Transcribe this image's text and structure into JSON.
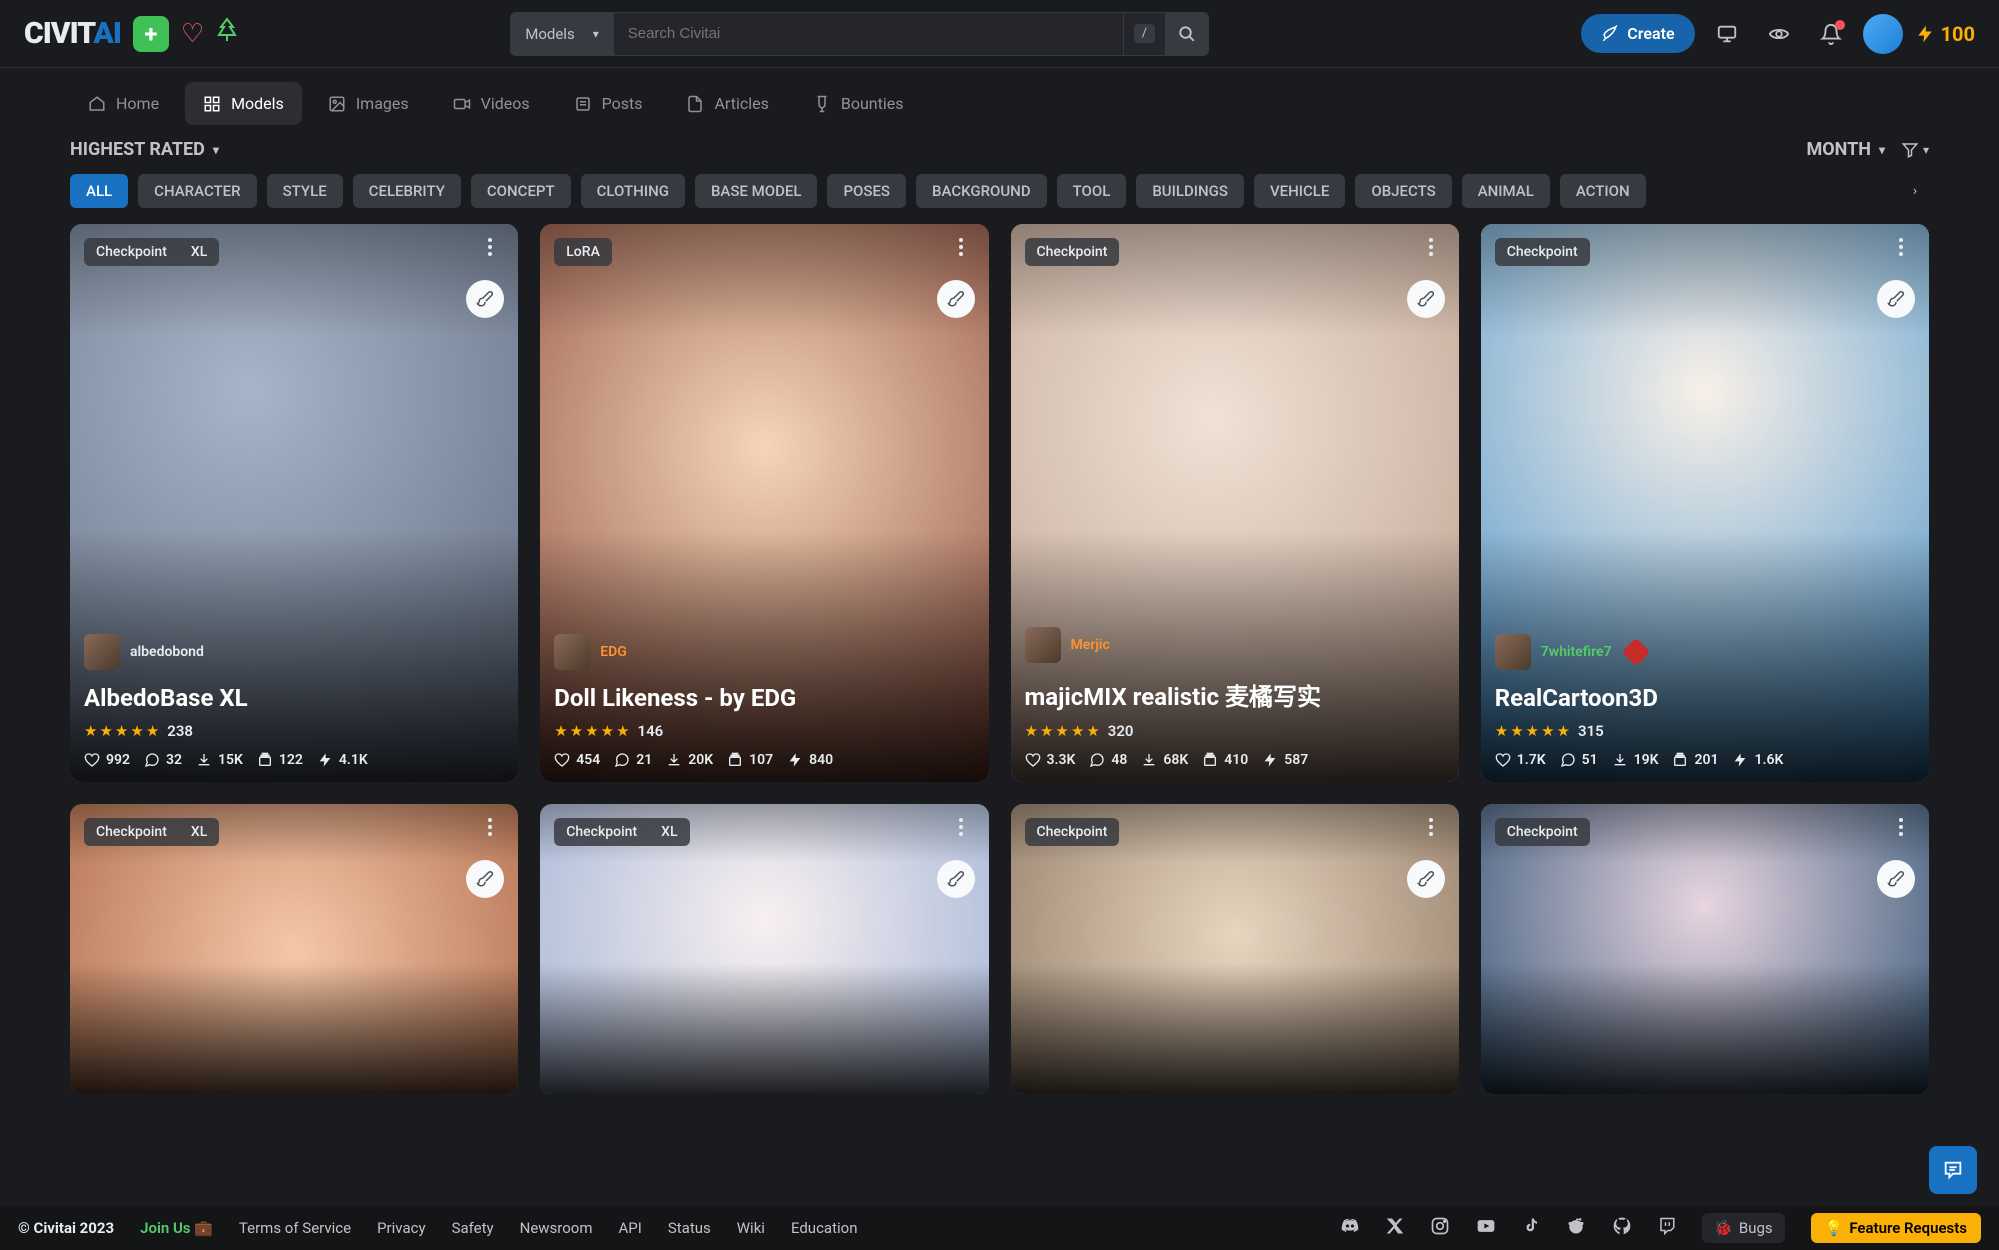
{
  "header": {
    "logo_left": "CIVIT",
    "logo_right": "AI",
    "search_select": "Models",
    "search_placeholder": "Search Civitai",
    "slash_key": "/",
    "create_label": "Create",
    "coins": "100"
  },
  "nav": {
    "items": [
      {
        "label": "Home"
      },
      {
        "label": "Models"
      },
      {
        "label": "Images"
      },
      {
        "label": "Videos"
      },
      {
        "label": "Posts"
      },
      {
        "label": "Articles"
      },
      {
        "label": "Bounties"
      }
    ]
  },
  "sort": {
    "label": "HIGHEST RATED",
    "period": "MONTH"
  },
  "tags": [
    "ALL",
    "CHARACTER",
    "STYLE",
    "CELEBRITY",
    "CONCEPT",
    "CLOTHING",
    "BASE MODEL",
    "POSES",
    "BACKGROUND",
    "TOOL",
    "BUILDINGS",
    "VEHICLE",
    "OBJECTS",
    "ANIMAL",
    "ACTION"
  ],
  "cards": [
    {
      "badges": [
        "Checkpoint",
        "XL"
      ],
      "author": "albedobond",
      "author_color": "",
      "title": "AlbedoBase XL",
      "rating": "238",
      "stats": {
        "likes": "992",
        "comments": "32",
        "downloads": "15K",
        "images": "122",
        "bolts": "4.1K"
      }
    },
    {
      "badges": [
        "LoRA"
      ],
      "author": "EDG",
      "author_color": "orange",
      "title": "Doll Likeness - by EDG",
      "rating": "146",
      "stats": {
        "likes": "454",
        "comments": "21",
        "downloads": "20K",
        "images": "107",
        "bolts": "840"
      }
    },
    {
      "badges": [
        "Checkpoint"
      ],
      "author": "Merjic",
      "author_color": "orange",
      "title": "majicMIX realistic 麦橘写实",
      "rating": "320",
      "stats": {
        "likes": "3.3K",
        "comments": "48",
        "downloads": "68K",
        "images": "410",
        "bolts": "587"
      }
    },
    {
      "badges": [
        "Checkpoint"
      ],
      "author": "7whitefire7",
      "author_color": "green",
      "title": "RealCartoon3D",
      "rating": "315",
      "stats": {
        "likes": "1.7K",
        "comments": "51",
        "downloads": "19K",
        "images": "201",
        "bolts": "1.6K"
      }
    },
    {
      "badges": [
        "Checkpoint",
        "XL"
      ]
    },
    {
      "badges": [
        "Checkpoint",
        "XL"
      ]
    },
    {
      "badges": [
        "Checkpoint"
      ]
    },
    {
      "badges": [
        "Checkpoint"
      ]
    }
  ],
  "footer": {
    "copyright": "© Civitai 2023",
    "join": "Join Us 💼",
    "links": [
      "Terms of Service",
      "Privacy",
      "Safety",
      "Newsroom",
      "API",
      "Status",
      "Wiki",
      "Education"
    ],
    "bugs": "Bugs",
    "requests": "Feature Requests"
  }
}
